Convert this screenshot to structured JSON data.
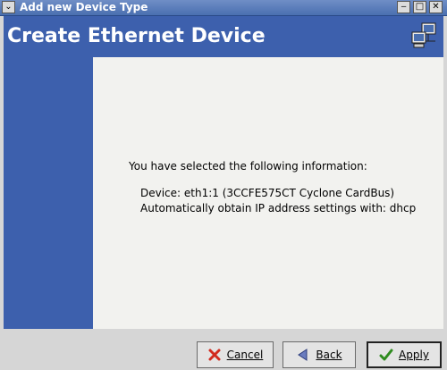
{
  "window": {
    "title": "Add new Device Type"
  },
  "header": {
    "title": "Create Ethernet Device",
    "icon": "network-computer-icon"
  },
  "content": {
    "intro": "You have selected the following information:",
    "device_line": "Device: eth1:1 (3CCFE575CT Cyclone CardBus)",
    "dhcp_line": "Automatically obtain IP address settings with: dhcp"
  },
  "buttons": {
    "cancel": "Cancel",
    "back": "Back",
    "apply": "Apply"
  },
  "colors": {
    "accent": "#3d60ad",
    "content_bg": "#f2f2ef",
    "cancel_icon": "#d22a1e",
    "back_icon": "#6a7cbf",
    "apply_icon": "#2e8b1e"
  }
}
